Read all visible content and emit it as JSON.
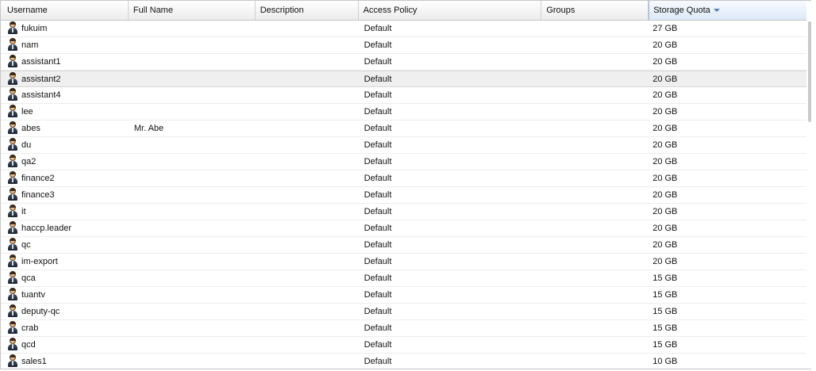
{
  "columns": [
    {
      "label": "Username"
    },
    {
      "label": "Full Name"
    },
    {
      "label": "Description"
    },
    {
      "label": "Access Policy"
    },
    {
      "label": "Groups"
    },
    {
      "label": "Storage Quota"
    }
  ],
  "sorted_column": "Storage Quota",
  "sort_direction": "descending",
  "selected_row_index": 3,
  "rows": [
    {
      "username": "fukuim",
      "full_name": "",
      "description": "",
      "access_policy": "Default",
      "groups": "",
      "storage_quota": "27 GB"
    },
    {
      "username": "nam",
      "full_name": "",
      "description": "",
      "access_policy": "Default",
      "groups": "",
      "storage_quota": "20 GB"
    },
    {
      "username": "assistant1",
      "full_name": "",
      "description": "",
      "access_policy": "Default",
      "groups": "",
      "storage_quota": "20 GB"
    },
    {
      "username": "assistant2",
      "full_name": "",
      "description": "",
      "access_policy": "Default",
      "groups": "",
      "storage_quota": "20 GB"
    },
    {
      "username": "assistant4",
      "full_name": "",
      "description": "",
      "access_policy": "Default",
      "groups": "",
      "storage_quota": "20 GB"
    },
    {
      "username": "lee",
      "full_name": "",
      "description": "",
      "access_policy": "Default",
      "groups": "",
      "storage_quota": "20 GB"
    },
    {
      "username": "abes",
      "full_name": "Mr. Abe",
      "description": "",
      "access_policy": "Default",
      "groups": "",
      "storage_quota": "20 GB"
    },
    {
      "username": "du",
      "full_name": "",
      "description": "",
      "access_policy": "Default",
      "groups": "",
      "storage_quota": "20 GB"
    },
    {
      "username": "qa2",
      "full_name": "",
      "description": "",
      "access_policy": "Default",
      "groups": "",
      "storage_quota": "20 GB"
    },
    {
      "username": "finance2",
      "full_name": "",
      "description": "",
      "access_policy": "Default",
      "groups": "",
      "storage_quota": "20 GB"
    },
    {
      "username": "finance3",
      "full_name": "",
      "description": "",
      "access_policy": "Default",
      "groups": "",
      "storage_quota": "20 GB"
    },
    {
      "username": "it",
      "full_name": "",
      "description": "",
      "access_policy": "Default",
      "groups": "",
      "storage_quota": "20 GB"
    },
    {
      "username": "haccp.leader",
      "full_name": "",
      "description": "",
      "access_policy": "Default",
      "groups": "",
      "storage_quota": "20 GB"
    },
    {
      "username": "qc",
      "full_name": "",
      "description": "",
      "access_policy": "Default",
      "groups": "",
      "storage_quota": "20 GB"
    },
    {
      "username": "im-export",
      "full_name": "",
      "description": "",
      "access_policy": "Default",
      "groups": "",
      "storage_quota": "20 GB"
    },
    {
      "username": "qca",
      "full_name": "",
      "description": "",
      "access_policy": "Default",
      "groups": "",
      "storage_quota": "15 GB"
    },
    {
      "username": "tuantv",
      "full_name": "",
      "description": "",
      "access_policy": "Default",
      "groups": "",
      "storage_quota": "15 GB"
    },
    {
      "username": "deputy-qc",
      "full_name": "",
      "description": "",
      "access_policy": "Default",
      "groups": "",
      "storage_quota": "15 GB"
    },
    {
      "username": "crab",
      "full_name": "",
      "description": "",
      "access_policy": "Default",
      "groups": "",
      "storage_quota": "15 GB"
    },
    {
      "username": "qcd",
      "full_name": "",
      "description": "",
      "access_policy": "Default",
      "groups": "",
      "storage_quota": "15 GB"
    },
    {
      "username": "sales1",
      "full_name": "",
      "description": "",
      "access_policy": "Default",
      "groups": "",
      "storage_quota": "10 GB"
    }
  ],
  "icons": {
    "row_icon": "user-icon",
    "sort_icon": "sort-descending-icon"
  }
}
